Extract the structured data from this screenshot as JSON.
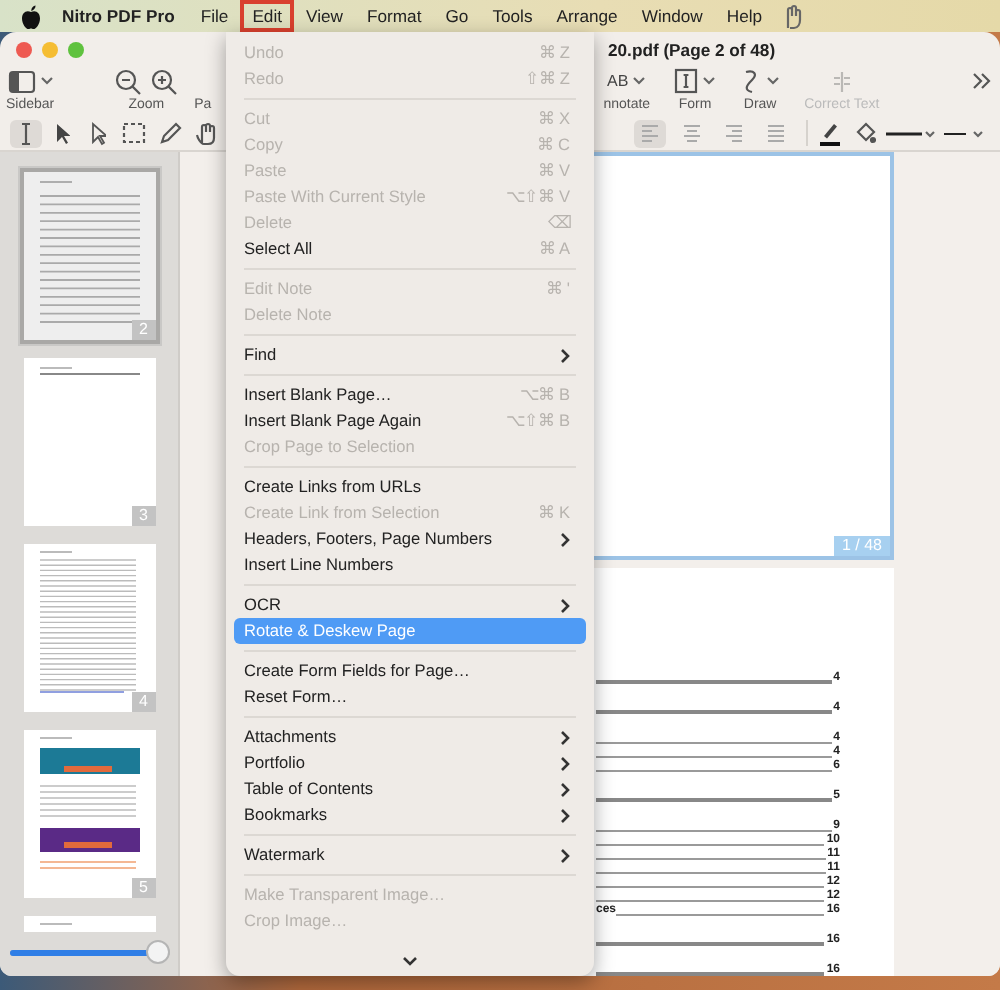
{
  "menu_bar": {
    "app_name": "Nitro PDF Pro",
    "menus": [
      {
        "label": "File",
        "selected": false
      },
      {
        "label": "Edit",
        "selected": true
      },
      {
        "label": "View",
        "selected": false
      },
      {
        "label": "Format",
        "selected": false
      },
      {
        "label": "Go",
        "selected": false
      },
      {
        "label": "Tools",
        "selected": false
      },
      {
        "label": "Arrange",
        "selected": false
      },
      {
        "label": "Window",
        "selected": false
      },
      {
        "label": "Help",
        "selected": false
      }
    ]
  },
  "window": {
    "title": "20.pdf (Page 2 of 48)"
  },
  "toolbar": {
    "left": [
      {
        "kind": "sidebar",
        "label": "Sidebar"
      },
      {
        "kind": "zoom",
        "label": "Zoom"
      },
      {
        "kind": "plain",
        "label": "Pa"
      }
    ],
    "right": [
      {
        "kind": "annotate",
        "label": "nnotate",
        "icon_text": "AB",
        "disabled": false
      },
      {
        "kind": "form",
        "label": "Form",
        "disabled": false
      },
      {
        "kind": "draw",
        "label": "Draw",
        "disabled": false
      },
      {
        "kind": "correct",
        "label": "Correct Text",
        "disabled": true
      }
    ]
  },
  "tools": [
    {
      "kind": "text",
      "selected": true
    },
    {
      "kind": "arrow",
      "selected": false
    },
    {
      "kind": "pointer",
      "selected": false
    },
    {
      "kind": "marquee",
      "selected": false
    },
    {
      "kind": "pencil",
      "selected": false
    },
    {
      "kind": "hand",
      "selected": false
    }
  ],
  "align": [
    {
      "kind": "left",
      "selected": true
    },
    {
      "kind": "center",
      "selected": false
    },
    {
      "kind": "right",
      "selected": false
    },
    {
      "kind": "justify",
      "selected": false
    }
  ],
  "sidebar": {
    "thumbnails": [
      {
        "kind": "toc",
        "page": "2",
        "selected": true
      },
      {
        "kind": "blank",
        "page": "3",
        "selected": false
      },
      {
        "kind": "text",
        "page": "4",
        "selected": false
      },
      {
        "kind": "banners",
        "page": "5",
        "selected": false
      },
      {
        "kind": "partial",
        "selected": false
      }
    ],
    "zoom": {
      "level": 0.93
    }
  },
  "edit_menu": {
    "items": [
      {
        "kind": "item",
        "label": "Undo",
        "shortcut": "⌘ Z",
        "disabled": true,
        "submenu": false,
        "selected": false
      },
      {
        "kind": "item",
        "label": "Redo",
        "shortcut": "⇧⌘ Z",
        "disabled": true,
        "submenu": false,
        "selected": false
      },
      {
        "kind": "separator"
      },
      {
        "kind": "item",
        "label": "Cut",
        "shortcut": "⌘ X",
        "disabled": true,
        "submenu": false,
        "selected": false
      },
      {
        "kind": "item",
        "label": "Copy",
        "shortcut": "⌘ C",
        "disabled": true,
        "submenu": false,
        "selected": false
      },
      {
        "kind": "item",
        "label": "Paste",
        "shortcut": "⌘ V",
        "disabled": true,
        "submenu": false,
        "selected": false
      },
      {
        "kind": "item",
        "label": "Paste With Current Style",
        "shortcut": "⌥⇧⌘ V",
        "disabled": true,
        "submenu": false,
        "selected": false
      },
      {
        "kind": "item",
        "label": "Delete",
        "shortcut": "⌫",
        "disabled": true,
        "submenu": false,
        "selected": false
      },
      {
        "kind": "item",
        "label": "Select All",
        "shortcut": "⌘ A",
        "disabled": false,
        "submenu": false,
        "selected": false
      },
      {
        "kind": "separator"
      },
      {
        "kind": "item",
        "label": "Edit Note",
        "shortcut": "⌘ '",
        "disabled": true,
        "submenu": false,
        "selected": false
      },
      {
        "kind": "item",
        "label": "Delete Note",
        "disabled": true,
        "submenu": false,
        "selected": false
      },
      {
        "kind": "separator"
      },
      {
        "kind": "item",
        "label": "Find",
        "disabled": false,
        "submenu": true,
        "selected": false
      },
      {
        "kind": "separator"
      },
      {
        "kind": "item",
        "label": "Insert Blank Page…",
        "shortcut": "⌥⌘ B",
        "disabled": false,
        "submenu": false,
        "selected": false
      },
      {
        "kind": "item",
        "label": "Insert Blank Page Again",
        "shortcut": "⌥⇧⌘ B",
        "disabled": false,
        "submenu": false,
        "selected": false
      },
      {
        "kind": "item",
        "label": "Crop Page to Selection",
        "disabled": true,
        "submenu": false,
        "selected": false
      },
      {
        "kind": "separator"
      },
      {
        "kind": "item",
        "label": "Create Links from URLs",
        "disabled": false,
        "submenu": false,
        "selected": false
      },
      {
        "kind": "item",
        "label": "Create Link from Selection",
        "shortcut": "⌘ K",
        "disabled": true,
        "submenu": false,
        "selected": false
      },
      {
        "kind": "item",
        "label": "Headers, Footers, Page Numbers",
        "disabled": false,
        "submenu": true,
        "selected": false
      },
      {
        "kind": "item",
        "label": "Insert Line Numbers",
        "disabled": false,
        "submenu": false,
        "selected": false
      },
      {
        "kind": "separator"
      },
      {
        "kind": "item",
        "label": "OCR",
        "disabled": false,
        "submenu": true,
        "selected": false
      },
      {
        "kind": "item",
        "label": "Rotate & Deskew Page",
        "disabled": false,
        "submenu": false,
        "selected": true
      },
      {
        "kind": "separator"
      },
      {
        "kind": "item",
        "label": "Create Form Fields for Page…",
        "disabled": false,
        "submenu": false,
        "selected": false
      },
      {
        "kind": "item",
        "label": "Reset Form…",
        "disabled": false,
        "submenu": false,
        "selected": false
      },
      {
        "kind": "separator"
      },
      {
        "kind": "item",
        "label": "Attachments",
        "disabled": false,
        "submenu": true,
        "selected": false
      },
      {
        "kind": "item",
        "label": "Portfolio",
        "disabled": false,
        "submenu": true,
        "selected": false
      },
      {
        "kind": "item",
        "label": "Table of Contents",
        "disabled": false,
        "submenu": true,
        "selected": false
      },
      {
        "kind": "item",
        "label": "Bookmarks",
        "disabled": false,
        "submenu": true,
        "selected": false
      },
      {
        "kind": "separator"
      },
      {
        "kind": "item",
        "label": "Watermark",
        "disabled": false,
        "submenu": true,
        "selected": false
      },
      {
        "kind": "separator"
      },
      {
        "kind": "item",
        "label": "Make Transparent Image…",
        "disabled": true,
        "submenu": false,
        "selected": false
      },
      {
        "kind": "item",
        "label": "Crop Image…",
        "disabled": true,
        "submenu": false,
        "selected": false
      }
    ]
  },
  "document": {
    "pages": [
      {
        "label": "1 / 48",
        "selected": true
      },
      {
        "selected": false,
        "toc": [
          {
            "kind": "heading",
            "page": "4"
          },
          {
            "kind": "heading",
            "page": "4"
          },
          {
            "kind": "entry",
            "page": "4"
          },
          {
            "kind": "entry",
            "page": "4"
          },
          {
            "kind": "entry",
            "page": "6"
          },
          {
            "kind": "heading",
            "page": "5"
          },
          {
            "kind": "entry",
            "page": "9"
          },
          {
            "kind": "entry",
            "page": "10"
          },
          {
            "kind": "entry",
            "page": "11"
          },
          {
            "kind": "entry",
            "page": "11"
          },
          {
            "kind": "entry",
            "page": "12"
          },
          {
            "kind": "entry",
            "page": "12"
          },
          {
            "kind": "entry",
            "text": "ces",
            "page": "16"
          },
          {
            "kind": "heading",
            "page": "16"
          },
          {
            "kind": "heading",
            "page": "16"
          }
        ]
      }
    ]
  }
}
